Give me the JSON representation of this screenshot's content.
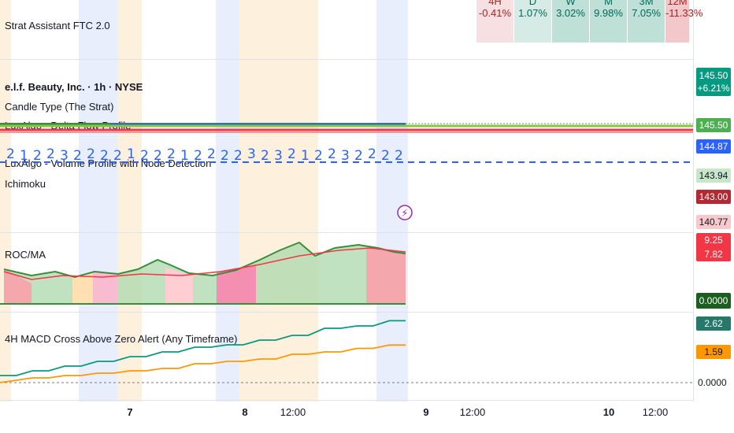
{
  "indicators": {
    "strat_assistant": "Strat Assistant FTC 2.0",
    "symbol_title": "e.l.f. Beauty, Inc. · 1h · NYSE",
    "candle_type": "Candle Type (The Strat)",
    "delta_flow": "LuxAlgo - Delta Flow Profile",
    "volume_profile": "LuxAlgo - Volume Profile with Node Detection",
    "ichimoku": "Ichimoku",
    "roc_ma": "ROC/MA",
    "macd_alert": "4H MACD Cross Above Zero Alert (Any Timeframe)"
  },
  "ftc_table": [
    {
      "tf": "4H",
      "pct": "-0.41%",
      "color": "#f7e0e2",
      "text": "#b71c1c"
    },
    {
      "tf": "D",
      "pct": "1.07%",
      "color": "#d6ebe5",
      "text": "#00695c"
    },
    {
      "tf": "W",
      "pct": "3.02%",
      "color": "#bfe0d6",
      "text": "#00695c"
    },
    {
      "tf": "M",
      "pct": "9.98%",
      "color": "#bfe0d6",
      "text": "#00695c"
    },
    {
      "tf": "3M",
      "pct": "7.05%",
      "color": "#bfe0d6",
      "text": "#00695c"
    },
    {
      "tf": "12M",
      "pct": "-11.33%",
      "color": "#f2c8cb",
      "text": "#b71c1c"
    }
  ],
  "price_axis": {
    "price_main": "145.50",
    "change_pct": "+6.21%",
    "p2": "145.50",
    "p3": "144.87",
    "p4": "143.94",
    "p5": "143.00",
    "p6": "140.77",
    "roc1": "9.25",
    "roc2": "7.82",
    "zero": "0.0000",
    "macd1": "2.62",
    "macd2": "1.59",
    "macd_zero": "0.0000"
  },
  "colors": {
    "teal": "#089981",
    "green": "#388e3c",
    "red": "#f23645",
    "blue": "#2962ff",
    "orange": "#ff9800",
    "darkred": "#b22833",
    "macd_teal": "#26a69a"
  },
  "strat_numbers": [
    "2",
    "1",
    "2",
    "2",
    "3",
    "2",
    "2",
    "2",
    "2",
    "1",
    "2",
    "2",
    "2",
    "1",
    "2",
    "2",
    "2",
    "2",
    "3",
    "2",
    "3",
    "2",
    "1",
    "2",
    "2",
    "3",
    "2",
    "2",
    "2",
    "2"
  ],
  "x_axis": [
    {
      "label": "7",
      "bold": true
    },
    {
      "label": "8",
      "bold": true
    },
    {
      "label": "12:00",
      "bold": false
    },
    {
      "label": "9",
      "bold": true
    },
    {
      "label": "12:00",
      "bold": false
    },
    {
      "label": "10",
      "bold": true
    },
    {
      "label": "12:00",
      "bold": false
    }
  ],
  "chart_data": {
    "type": "line",
    "series": [
      {
        "values": [
          0.3,
          0.3,
          0.5,
          0.5,
          0.7,
          0.7,
          0.9,
          0.9,
          1.1,
          1.1,
          1.3,
          1.3,
          1.5,
          1.5,
          1.6,
          1.6,
          1.8,
          1.8,
          2.0,
          2.0,
          2.3,
          2.3,
          2.4,
          2.4,
          2.62,
          2.62
        ]
      },
      {
        "values": [
          0.0,
          0.1,
          0.2,
          0.2,
          0.3,
          0.3,
          0.4,
          0.4,
          0.5,
          0.5,
          0.6,
          0.6,
          0.8,
          0.8,
          0.9,
          0.9,
          1.0,
          1.0,
          1.2,
          1.2,
          1.3,
          1.3,
          1.45,
          1.45,
          1.59,
          1.59
        ]
      }
    ]
  }
}
